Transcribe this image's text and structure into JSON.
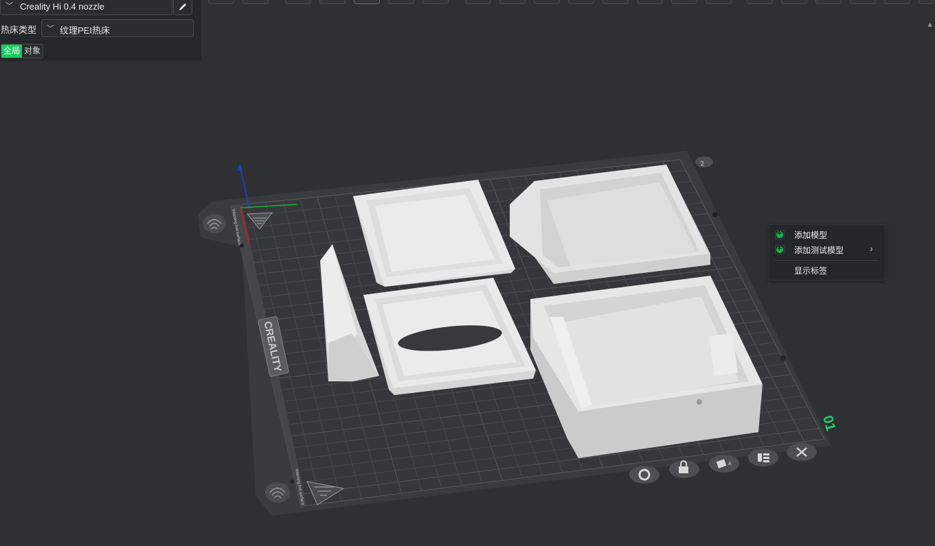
{
  "printer": {
    "name": "Creality Hi 0.4 nozzle"
  },
  "bed": {
    "label": "热床类型",
    "value": "纹理PEI热床"
  },
  "scope_toggle": {
    "global": "全局",
    "object": "对象"
  },
  "plate": {
    "brand": "CREALITY",
    "number": "01",
    "warning_text": "Warning hot surface",
    "colors": {
      "plate": "#38393d",
      "grid": "#4d4e53",
      "accent": "#1fce6a",
      "model": "#e6e6e6"
    }
  },
  "context_menu": {
    "items": [
      {
        "label": "添加模型",
        "icon": "plus-icon"
      },
      {
        "label": "添加测试模型",
        "icon": "plus-icon",
        "submenu": true
      },
      {
        "label": "显示标签"
      }
    ]
  },
  "plate_controls": [
    "gear-icon",
    "lock-icon",
    "auto-orient-icon",
    "arrange-icon",
    "close-icon"
  ]
}
